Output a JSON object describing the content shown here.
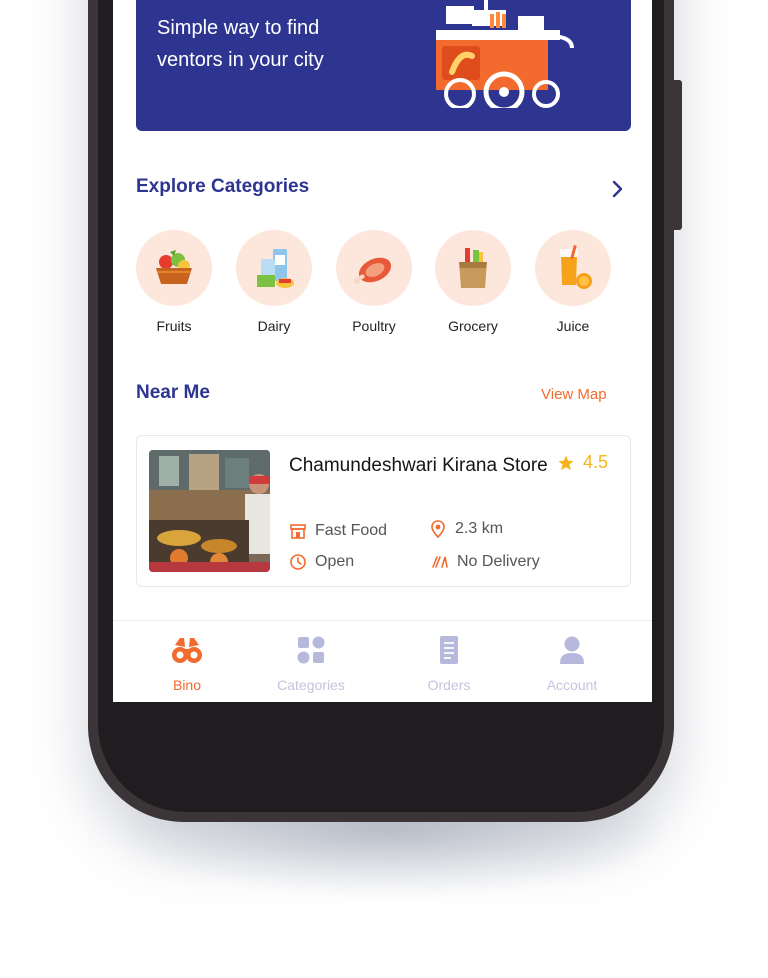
{
  "banner": {
    "text": "Simple way to find ventors in your city"
  },
  "categories": {
    "title": "Explore Categories",
    "items": [
      {
        "label": "Fruits",
        "icon": "fruit-basket-icon"
      },
      {
        "label": "Dairy",
        "icon": "dairy-icon"
      },
      {
        "label": "Poultry",
        "icon": "poultry-icon"
      },
      {
        "label": "Grocery",
        "icon": "grocery-bag-icon"
      },
      {
        "label": "Juice",
        "icon": "juice-icon"
      }
    ]
  },
  "near_me": {
    "title": "Near Me",
    "view_map": "View Map",
    "store": {
      "name": "Chamundeshwari Kirana Store",
      "rating": "4.5",
      "type": "Fast Food",
      "distance": "2.3 km",
      "status": "Open",
      "delivery": "No Delivery"
    }
  },
  "nav": {
    "items": [
      {
        "label": "Bino",
        "active": true
      },
      {
        "label": "Categories",
        "active": false
      },
      {
        "label": "Orders",
        "active": false
      },
      {
        "label": "Account",
        "active": false
      }
    ]
  },
  "colors": {
    "primary": "#2d3591",
    "accent": "#f26a2e",
    "star": "#f5b419",
    "category_bg": "#fde7dc"
  }
}
